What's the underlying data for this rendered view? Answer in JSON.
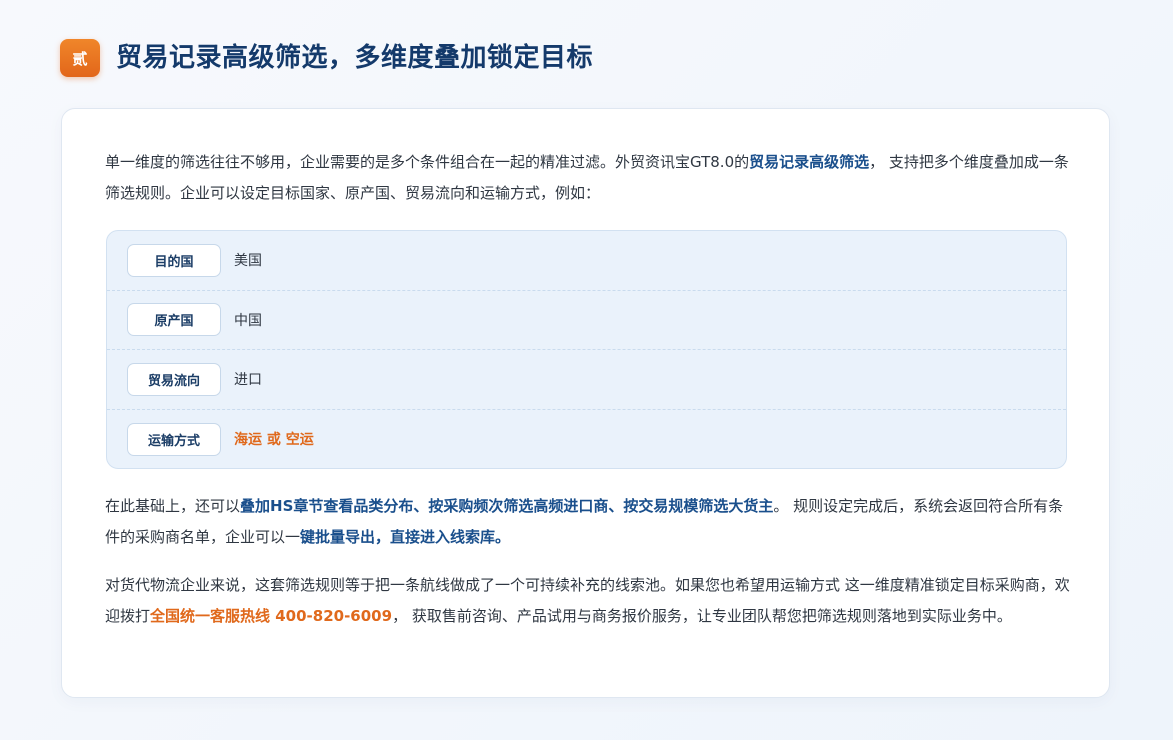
{
  "header": {
    "badge": "贰",
    "title": "贸易记录高级筛选，多维度叠加锁定目标"
  },
  "intro": {
    "text_1": "单一维度的筛选往往不够用，企业需要的是多个条件组合在一起的精准过滤。外贸资讯宝GT8.0的",
    "highlight": "贸易记录高级筛选",
    "text_2": "， 支持把多个维度叠加成一条筛选规则。企业可以设定目标国家、原产国、贸易流向和运输方式，例如："
  },
  "filters": [
    {
      "key": "目的国",
      "value": "美国"
    },
    {
      "key": "原产国",
      "value": "中国"
    },
    {
      "key": "贸易流向",
      "value": "进口"
    },
    {
      "key": "运输方式",
      "value": "海运 或 空运"
    }
  ],
  "para2": {
    "text_1": "在此基础上，还可以",
    "highlight_1": "叠加HS章节查看品类分布、按采购频次筛选高频进口商、按交易规模筛选大货主",
    "text_2": "。 规则设定完成后，系统会返回符合所有条件的采购商名单，企业可以一",
    "highlight_2": "键批量导出，直接进入线索库。"
  },
  "para3": {
    "text_1": "对货代物流企业来说，这套筛选规则等于把一条航线做成了一个可持续补充的线索池。如果您也希望用运输方式 这一维度精准锁定目标采购商，欢迎拨打",
    "highlight": "全国统一客服热线 400-820-6009",
    "text_2": "， 获取售前咨询、产品试用与商务报价服务，让专业团队帮您把筛选规则落地到实际业务中。"
  },
  "colors": {
    "accent_orange": "#e0691c",
    "title_blue": "#143a6b",
    "highlight_blue": "#1a4f8c"
  }
}
